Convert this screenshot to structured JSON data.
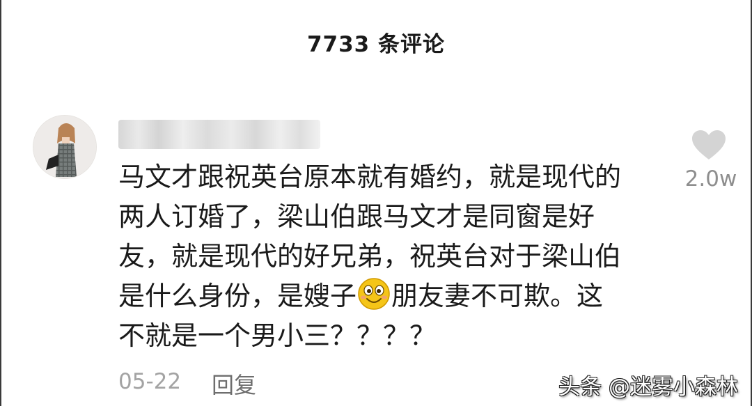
{
  "header": {
    "title": "7733 条评论"
  },
  "comment": {
    "avatar_icon": "user-avatar-photo",
    "username": "",
    "lines": [
      "马文才跟祝英台原本就有婚约，就是现代的",
      "两人订婚了，梁山伯跟马文才是同窗是好",
      "友，就是现代的好兄弟，祝英台对于梁山伯",
      "是什么身份，是嫂子",
      "朋友妻不可欺。这",
      "不就是一个男小三？？？？"
    ],
    "emoji_icon": "grinning-face-emoji",
    "date": "05-22",
    "reply_label": "回复",
    "like_icon": "heart-icon",
    "like_count": "2.0w"
  },
  "watermark": {
    "text": "头条 @迷雾小森林"
  },
  "colors": {
    "text_primary": "#1a1a1a",
    "text_secondary": "#8e8e8e",
    "heart": "#d4d4d4",
    "emoji_yellow": "#f5c518"
  }
}
